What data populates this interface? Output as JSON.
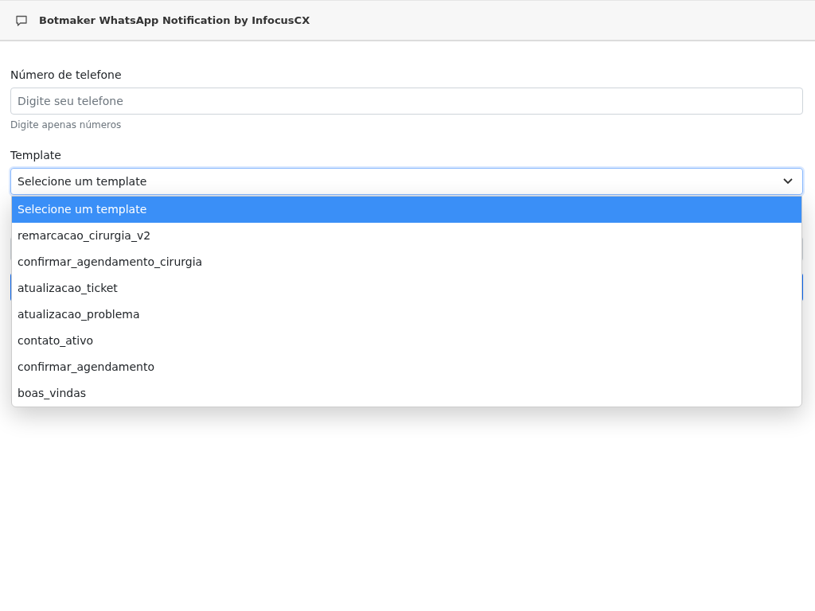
{
  "header": {
    "title": "Botmaker WhatsApp Notification by InfocusCX"
  },
  "phone": {
    "label": "Número de telefone",
    "placeholder": "Digite seu telefone",
    "help": "Digite apenas números"
  },
  "template": {
    "label": "Template",
    "value": "Selecione um template",
    "options": [
      {
        "label": "Selecione um template",
        "selected": true
      },
      {
        "label": "remarcacao_cirurgia_v2",
        "selected": false
      },
      {
        "label": "confirmar_agendamento_cirurgia",
        "selected": false
      },
      {
        "label": "atualizacao_ticket",
        "selected": false
      },
      {
        "label": "atualizacao_problema",
        "selected": false
      },
      {
        "label": "contato_ativo",
        "selected": false
      },
      {
        "label": "confirmar_agendamento",
        "selected": false
      },
      {
        "label": "boas_vindas",
        "selected": false
      }
    ]
  }
}
